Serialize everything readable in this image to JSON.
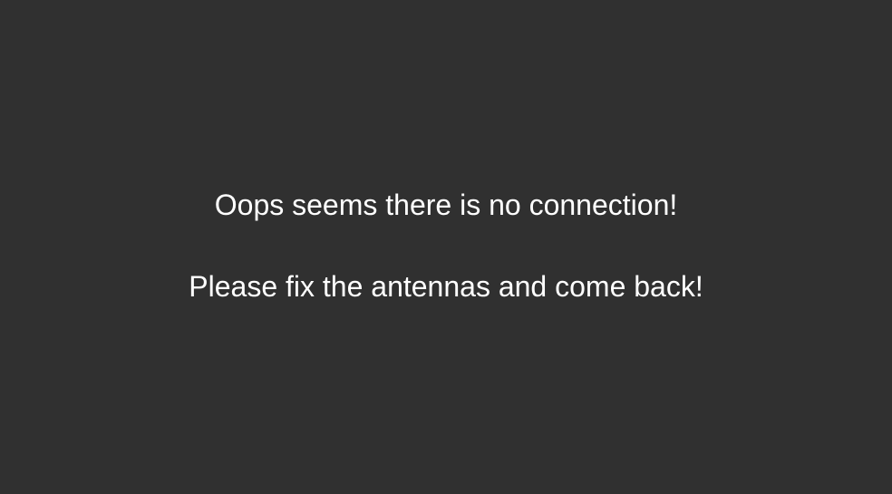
{
  "message": {
    "line_1": "Oops seems there is no connection!",
    "line_2": "Please fix the antennas and come back!"
  },
  "colors": {
    "background": "#303030",
    "text": "#ffffff"
  }
}
